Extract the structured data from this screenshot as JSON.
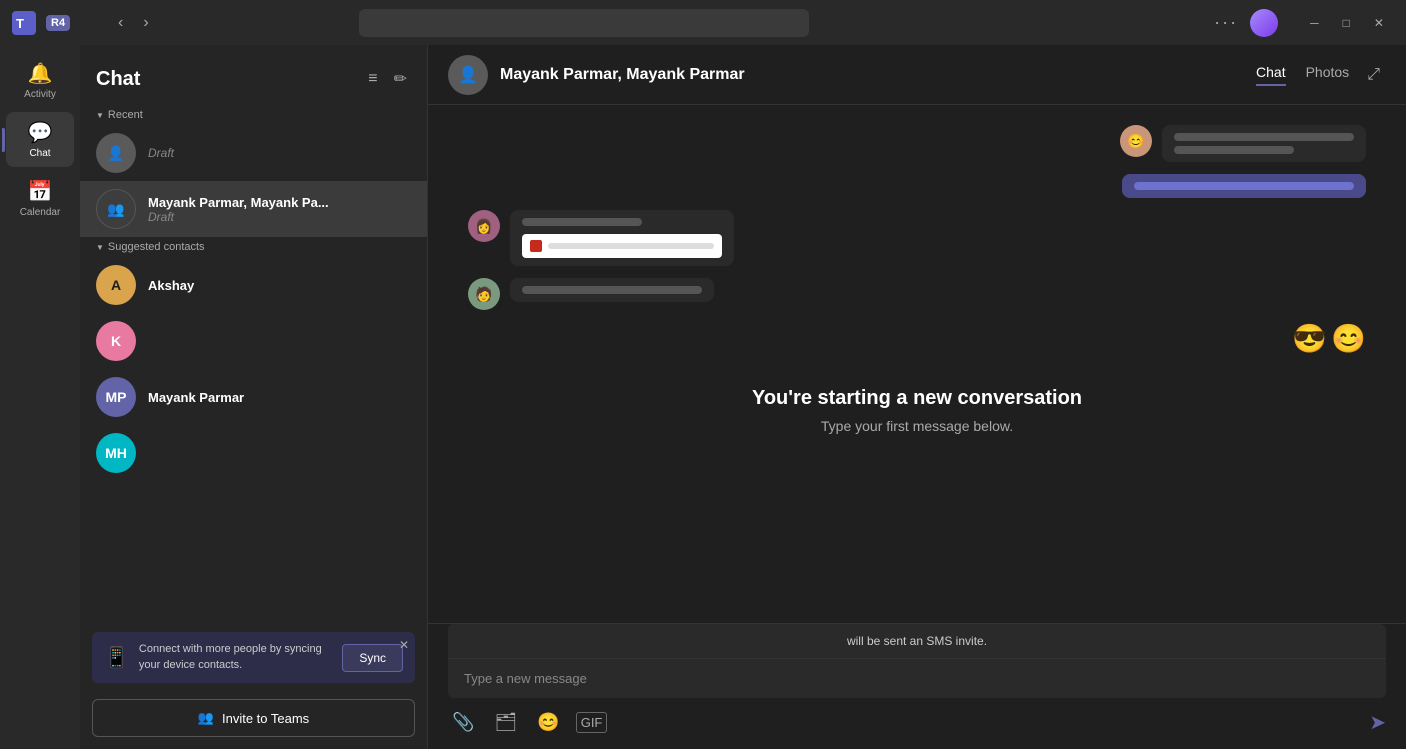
{
  "titlebar": {
    "app_name": "Teams",
    "user_badge": "R4",
    "nav_back": "‹",
    "nav_forward": "›",
    "more": "···",
    "minimize": "─",
    "maximize": "□",
    "close": "✕"
  },
  "sidebar": {
    "items": [
      {
        "id": "activity",
        "label": "Activity",
        "icon": "🔔",
        "active": false
      },
      {
        "id": "chat",
        "label": "Chat",
        "icon": "💬",
        "active": true
      },
      {
        "id": "calendar",
        "label": "Calendar",
        "icon": "📅",
        "active": false
      }
    ]
  },
  "chat_panel": {
    "title": "Chat",
    "sections": {
      "recent": {
        "label": "Recent",
        "items": [
          {
            "id": "draft1",
            "name": "Draft",
            "sub": "Draft",
            "avatar_type": "gray",
            "avatar_text": "👤"
          },
          {
            "id": "mayank1",
            "name": "Mayank Parmar, Mayank Pa...",
            "sub": "Draft",
            "avatar_type": "group",
            "avatar_text": "👥"
          }
        ]
      },
      "suggested": {
        "label": "Suggested contacts",
        "items": [
          {
            "id": "akshay",
            "name": "Akshay",
            "sub": "",
            "avatar_type": "yellow",
            "avatar_text": "A"
          },
          {
            "id": "k",
            "name": "",
            "sub": "",
            "avatar_type": "pink",
            "avatar_text": "K"
          },
          {
            "id": "mayank2",
            "name": "Mayank Parmar",
            "sub": "",
            "avatar_type": "purple",
            "avatar_text": "MP"
          },
          {
            "id": "mh",
            "name": "",
            "sub": "",
            "avatar_type": "teal",
            "avatar_text": "MH"
          }
        ]
      }
    },
    "sync_banner": {
      "text": "Connect with more people by syncing your device contacts.",
      "sync_label": "Sync",
      "close": "✕"
    },
    "invite_label": "Invite to Teams",
    "invite_icon": "👥"
  },
  "chat_main": {
    "header": {
      "name": "Mayank Parmar, Mayank Parmar",
      "avatar_icon": "👤",
      "tabs": [
        {
          "id": "chat",
          "label": "Chat",
          "active": true
        },
        {
          "id": "photos",
          "label": "Photos",
          "active": false
        }
      ],
      "expand_icon": "⤢"
    },
    "messages": [
      {
        "side": "right",
        "avatar": "av1",
        "type": "bubble",
        "lines": [
          "medium",
          "short"
        ]
      },
      {
        "side": "right",
        "avatar": null,
        "type": "bubble-purple",
        "lines": [
          "long"
        ]
      },
      {
        "side": "left",
        "avatar": "av2",
        "type": "bubble-attachment",
        "lines": [
          "short"
        ]
      },
      {
        "side": "left",
        "avatar": "av3",
        "type": "bubble",
        "lines": [
          "medium"
        ]
      },
      {
        "side": "right",
        "avatar": null,
        "type": "emoji",
        "emoji": "😎😊"
      }
    ],
    "conversation_start": {
      "title": "You're starting a new conversation",
      "subtitle": "Type your first message below."
    },
    "input": {
      "sms_notice": "will be sent an SMS invite.",
      "placeholder": "Type a new message",
      "toolbar_icons": [
        "attach",
        "paperclip",
        "emoji",
        "gif"
      ],
      "send_icon": "➤"
    }
  }
}
